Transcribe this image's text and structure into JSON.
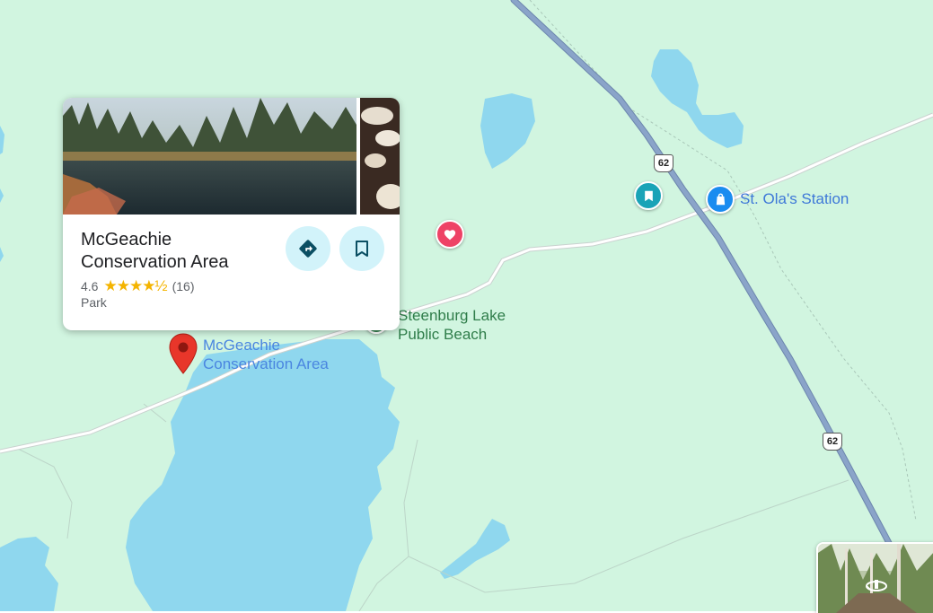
{
  "map": {
    "colors": {
      "land": "#d1f5e0",
      "water": "#8fd7ee",
      "road": "#8aa4c9",
      "minor_road": "#ffffff"
    }
  },
  "labels": {
    "beach": [
      "Steenburg Lake",
      "Public Beach"
    ],
    "station": "St. Ola's Station",
    "mcgeachie": [
      "McGeachie",
      "Conservation Area"
    ]
  },
  "route_shields": [
    "62",
    "62"
  ],
  "icons": {
    "heart_pin": "heart-icon",
    "saved_pin": "bookmark-icon",
    "shopping_pin": "shopping-bag-icon",
    "red_pin": "location-pin-icon",
    "directions": "directions-icon",
    "save": "bookmark-icon",
    "street_view": "rotate-360-icon"
  },
  "place_card": {
    "name_line1": "McGeachie",
    "name_line2": "Conservation Area",
    "rating": "4.6",
    "stars": 4.6,
    "stars_text": "★★★★½",
    "review_count": "(16)",
    "category": "Park"
  }
}
